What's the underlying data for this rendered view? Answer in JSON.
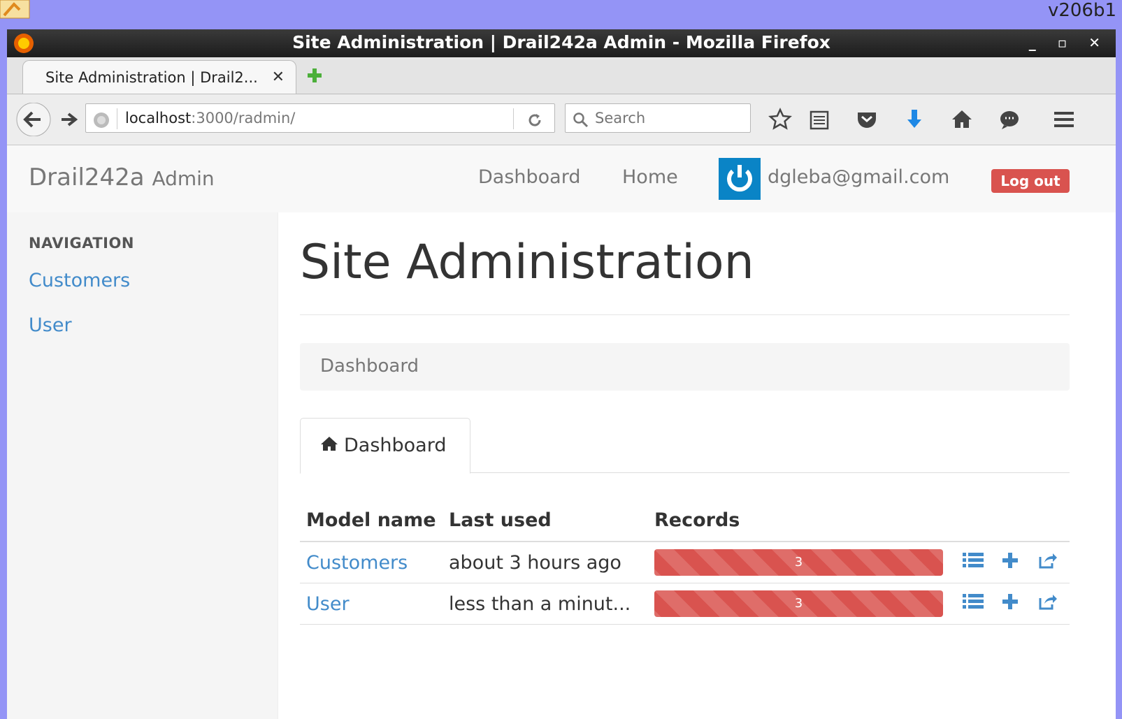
{
  "desktop": {
    "version": "v206b1"
  },
  "window": {
    "title": "Site Administration | Drail242a Admin - Mozilla Firefox"
  },
  "browser": {
    "tab_title": "Site Administration | Drail2...",
    "url_host": "localhost",
    "url_path": ":3000/radmin/",
    "search_placeholder": "Search"
  },
  "header": {
    "brand": "Drail242a",
    "brand_small": "Admin",
    "links": [
      "Dashboard",
      "Home"
    ],
    "email": "dgleba@gmail.com",
    "logout_label": "Log out"
  },
  "sidebar": {
    "heading": "NAVIGATION",
    "items": [
      {
        "label": "Customers"
      },
      {
        "label": "User"
      }
    ]
  },
  "main": {
    "title": "Site Administration",
    "breadcrumb": "Dashboard",
    "tab_label": "Dashboard",
    "columns": [
      "Model name",
      "Last used",
      "Records"
    ],
    "rows": [
      {
        "name": "Customers",
        "last_used": "about 3 hours ago",
        "records": "3",
        "records_fraction": 1.0
      },
      {
        "name": "User",
        "last_used": "less than a minut...",
        "records": "3",
        "records_fraction": 1.0
      }
    ]
  },
  "colors": {
    "accent": "#428bca",
    "danger": "#d9534f",
    "avatar_bg": "#0a84c6"
  }
}
